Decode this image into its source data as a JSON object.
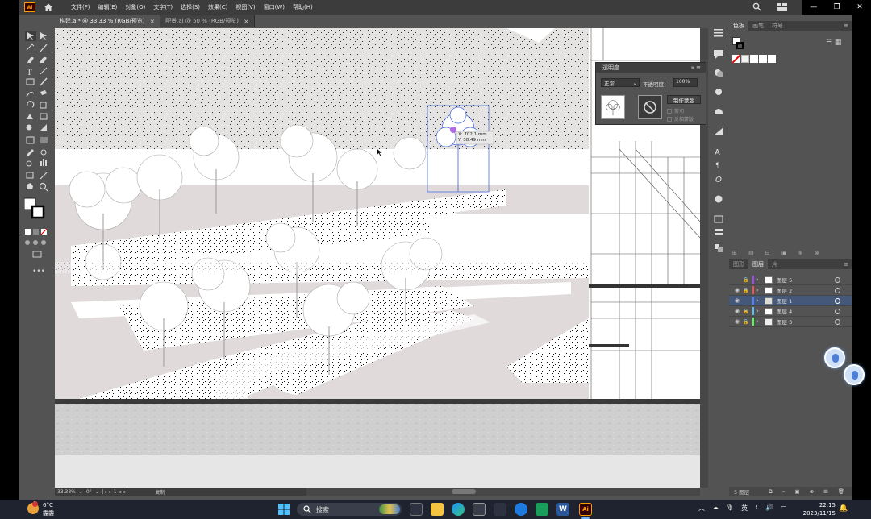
{
  "menubar": {
    "app_badge": "Ai",
    "items": [
      "文件(F)",
      "编辑(E)",
      "对象(O)",
      "文字(T)",
      "选择(S)",
      "效果(C)",
      "视图(V)",
      "窗口(W)",
      "帮助(H)"
    ]
  },
  "tabs": [
    {
      "label": "构建.ai* @ 33.33 % (RGB/预览)",
      "active": true
    },
    {
      "label": "配景.ai @ 50 % (RGB/预览)",
      "active": false
    }
  ],
  "transparency_panel": {
    "title": "透明度",
    "blend_mode": "正常",
    "opacity_label": "不透明度：",
    "opacity_value": "100%",
    "make_mask_button": "制作蒙版",
    "clip_label": "剪切",
    "invert_label": "反相蒙版"
  },
  "selection_tooltip": {
    "x": "X: 702.1 mm",
    "y": "Y: 38.49 mm"
  },
  "swatch_panel": {
    "tabs": [
      "色板",
      "画笔",
      "符号"
    ],
    "active_tab": "色板"
  },
  "layers_panel": {
    "tabs": [
      "图形",
      "图层",
      "片"
    ],
    "active_tab": "图层",
    "layers": [
      {
        "name": "图层 5",
        "color": "#a046ff",
        "visible": false,
        "selected": false
      },
      {
        "name": "图层 2",
        "color": "#ff4f4f",
        "visible": true,
        "selected": false
      },
      {
        "name": "图层 1",
        "color": "#4f80ff",
        "visible": true,
        "selected": true
      },
      {
        "name": "图层 4",
        "color": "#4fbfff",
        "visible": true,
        "selected": false
      },
      {
        "name": "图层 3",
        "color": "#4fff4f",
        "visible": true,
        "selected": false
      }
    ],
    "footer": "5 图层"
  },
  "statusbar": {
    "zoom": "33.33%",
    "rotation": "0°",
    "artboard": "1",
    "tool": "复制"
  },
  "taskbar": {
    "weather_temp": "6°C",
    "weather_desc": "霾霾",
    "search_label": "搜索",
    "ime": "英",
    "time": "22:15",
    "date": "2023/11/15"
  }
}
